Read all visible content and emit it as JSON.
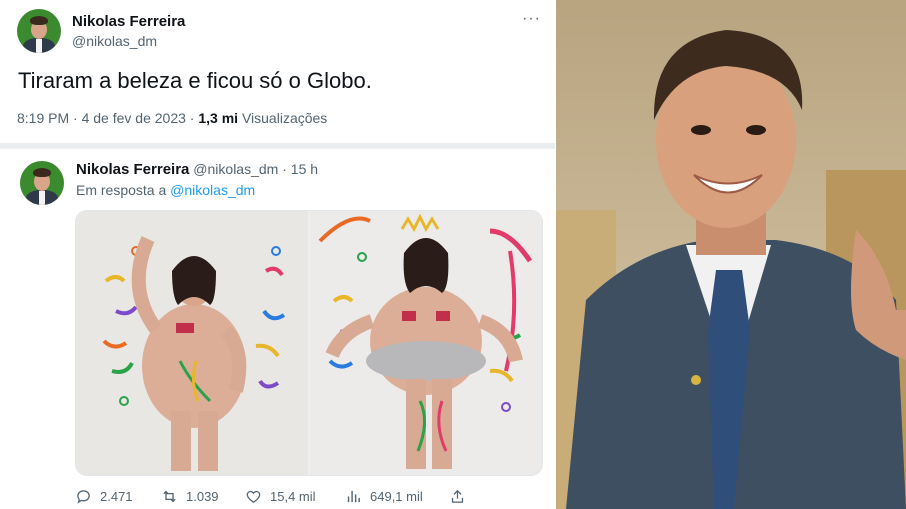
{
  "tweet": {
    "author_name": "Nikolas Ferreira",
    "author_handle": "@nikolas_dm",
    "text": "Tiraram a beleza e ficou só o Globo.",
    "time": "8:19 PM",
    "date": "4 de fev de 2023",
    "views_count": "1,3 mi",
    "views_label": "Visualizações",
    "more_icon": "more-dots-icon"
  },
  "reply": {
    "author_name": "Nikolas Ferreira",
    "author_handle": "@nikolas_dm",
    "age": "15 h",
    "reply_prefix": "Em resposta a",
    "reply_handle": "@nikolas_dm",
    "actions": {
      "replies": "2.471",
      "retweets": "1.039",
      "likes": "15,4 mil",
      "views": "649,1 mil"
    }
  },
  "colors": {
    "link": "#1d9bf0",
    "text": "#0f1419",
    "muted": "#536471",
    "avatar_bg": "#3b8a2e"
  }
}
